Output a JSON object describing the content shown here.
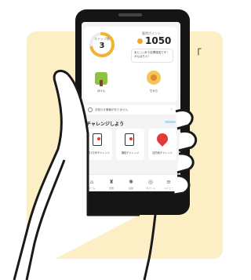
{
  "background": {
    "card_color": "#fcefc6",
    "quote_text": "「"
  },
  "app": {
    "ring": {
      "label": "ステップ数",
      "value": "3",
      "accent": "#f2b234"
    },
    "points": {
      "label": "獲得ポイント",
      "value": "1050",
      "coin_color": "#f2a531"
    },
    "bubble_text": "あと○○歩で目標達成です！がんばろう！",
    "stats": [
      {
        "label": "ほけん",
        "icon": "tree-icon"
      },
      {
        "label": "ちから",
        "icon": "medal-icon"
      }
    ],
    "notice": {
      "text": "お知らせ情報がありません",
      "icon": "gear-icon",
      "arrow": "›"
    },
    "challenge": {
      "title": "チャレンジしよう",
      "cards": [
        {
          "label": "1日1万歩チャレンジ",
          "icon": "door-icon"
        },
        {
          "label": "階段チャレンジ",
          "icon": "door-icon"
        },
        {
          "label": "目的地チャレンジ",
          "icon": "pin-icon"
        }
      ]
    },
    "tabs": [
      {
        "label": "ホーム",
        "glyph": "⌂",
        "icon": "home-icon",
        "active": true
      },
      {
        "label": "歩数",
        "glyph": "♜",
        "icon": "steps-icon",
        "active": false
      },
      {
        "label": "記録",
        "glyph": "✺",
        "icon": "record-icon",
        "active": false
      },
      {
        "label": "ポイント",
        "glyph": "◎",
        "icon": "points-icon",
        "active": false
      },
      {
        "label": "メニュー",
        "glyph": "≡",
        "icon": "menu-icon",
        "active": false
      }
    ]
  }
}
